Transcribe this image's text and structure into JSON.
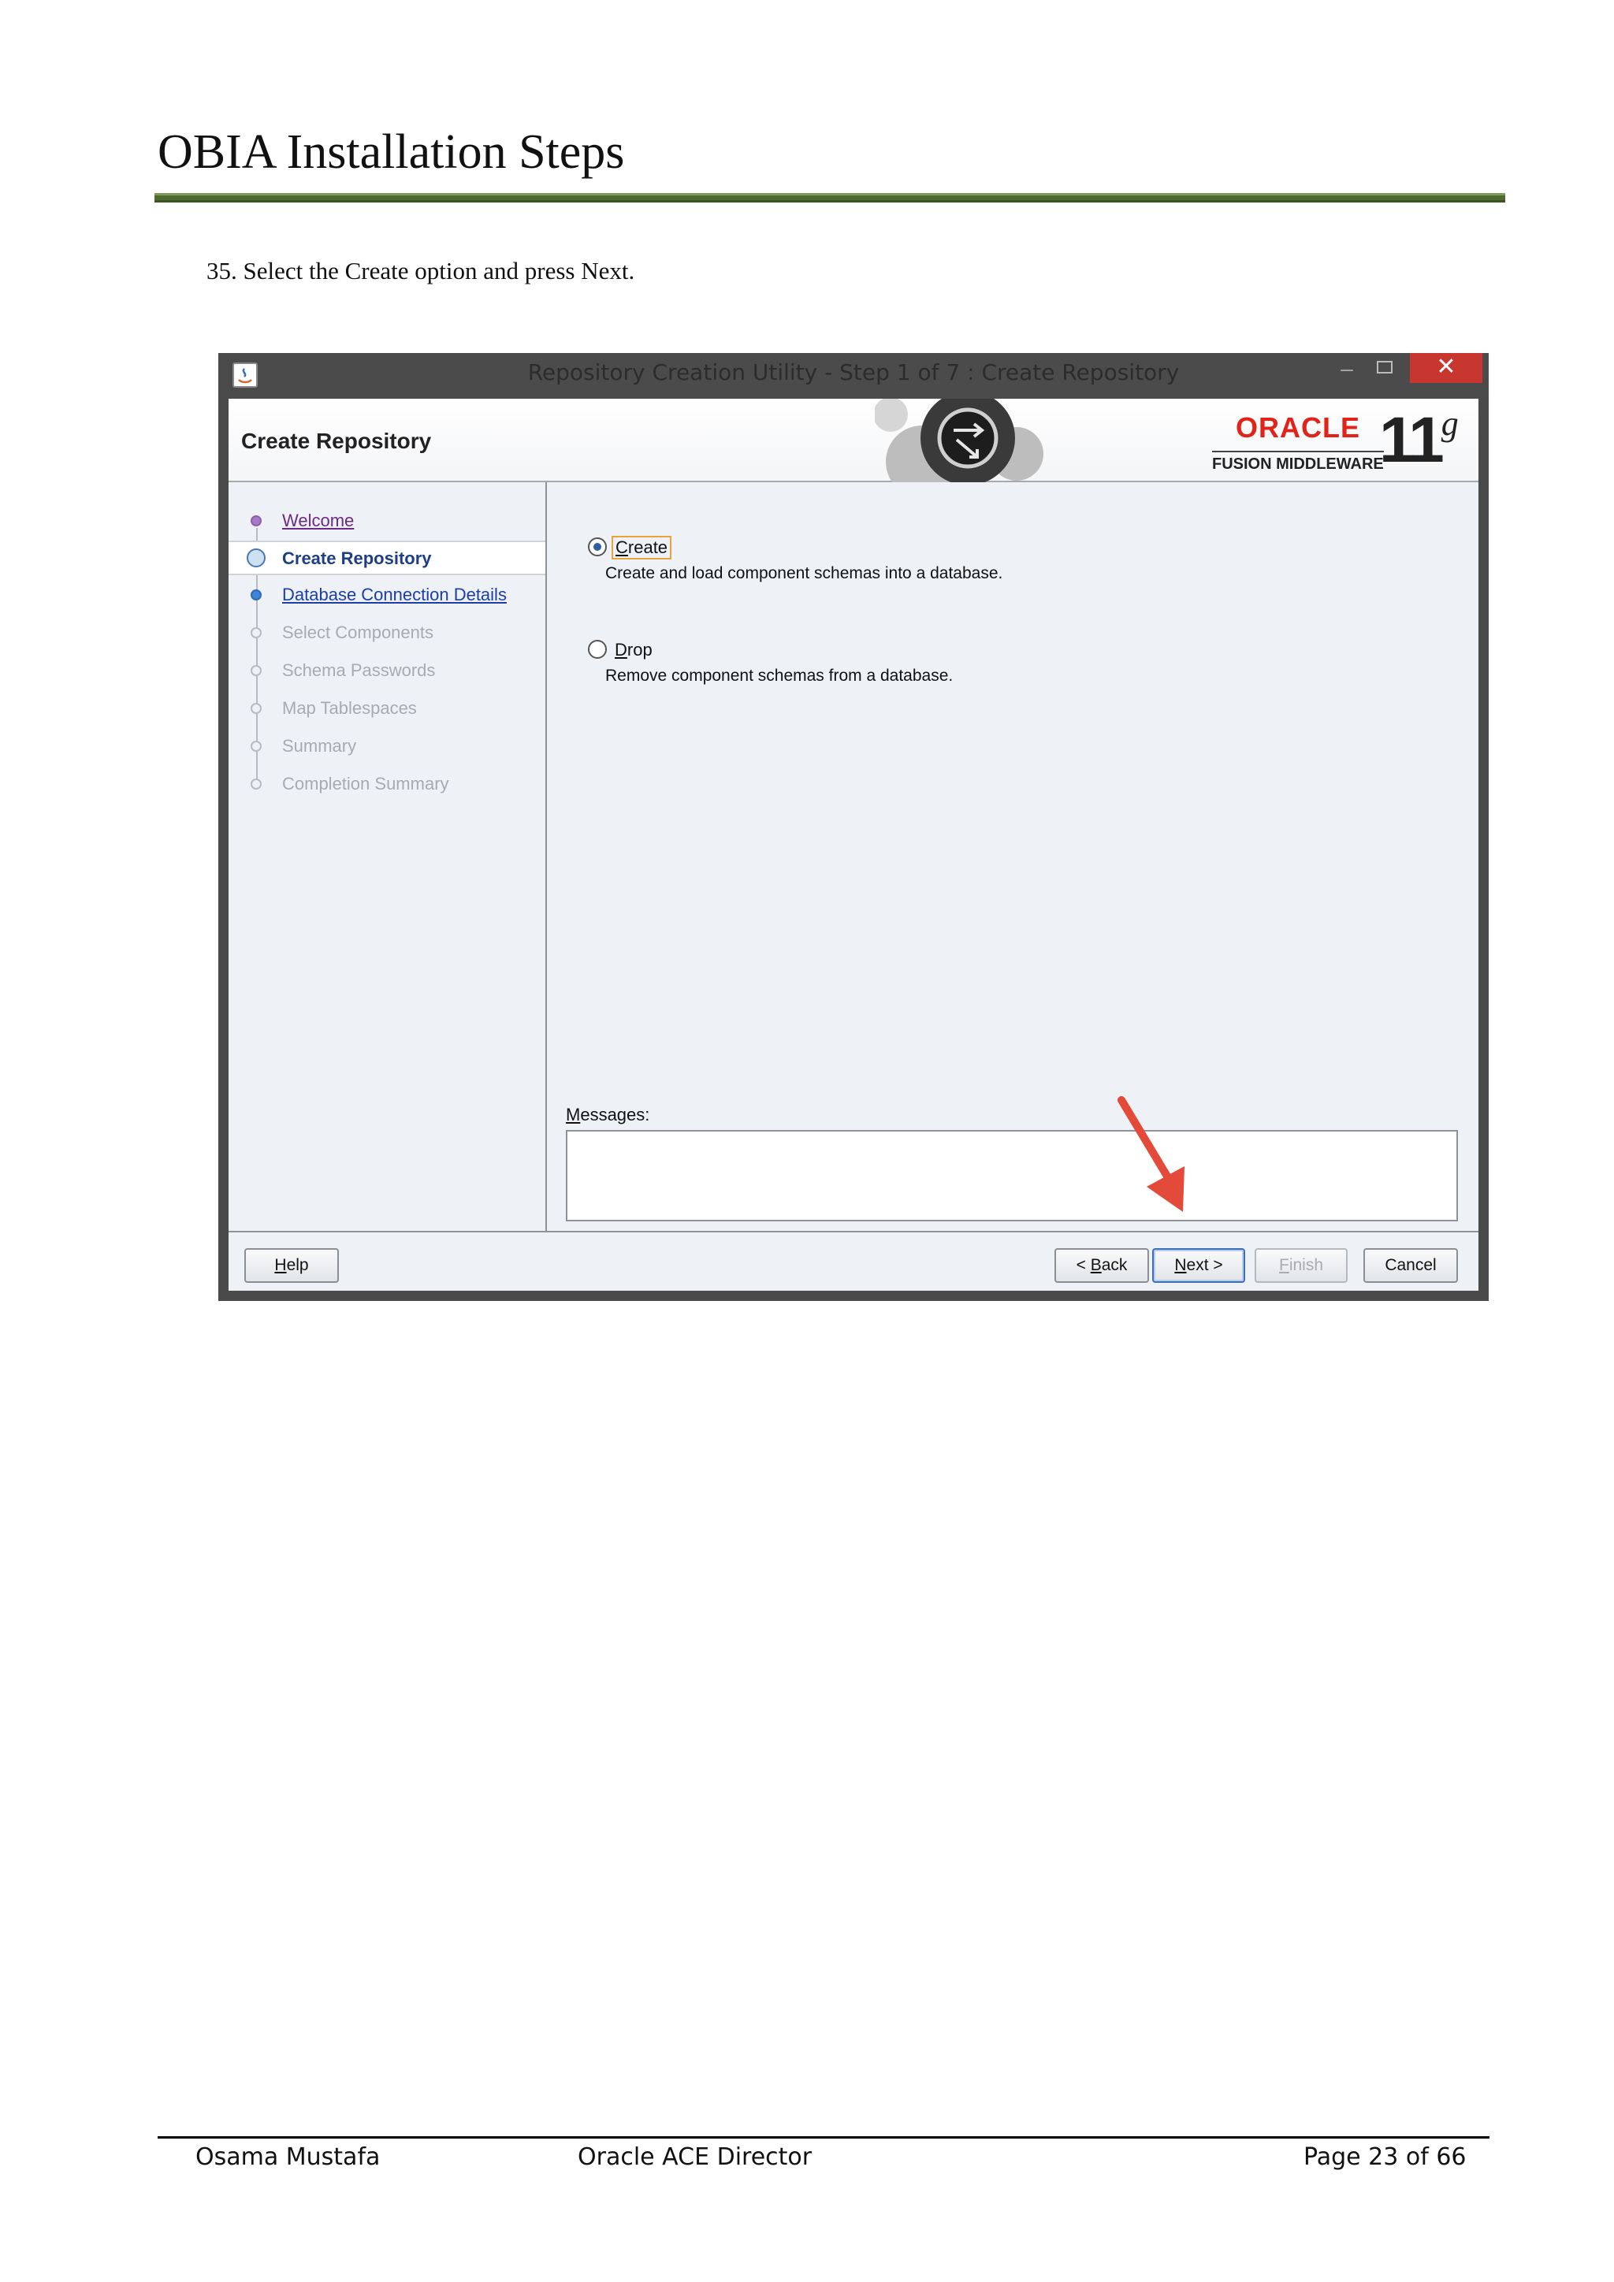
{
  "document": {
    "title": "OBIA Installation Steps",
    "step": "35.  Select the Create option and press Next."
  },
  "window": {
    "title": "Repository Creation Utility - Step 1 of 7 : Create Repository",
    "close_glyph": "✕",
    "minimize_glyph": "–",
    "heading": "Create Repository",
    "brand": {
      "oracle": "ORACLE",
      "fusion": "FUSION MIDDLEWARE",
      "version": "11",
      "version_suffix": "g"
    }
  },
  "nav": {
    "items": [
      {
        "label": "Welcome"
      },
      {
        "label": "Create Repository"
      },
      {
        "label": "Database Connection Details"
      },
      {
        "label": "Select Components"
      },
      {
        "label": "Schema Passwords"
      },
      {
        "label": "Map Tablespaces"
      },
      {
        "label": "Summary"
      },
      {
        "label": "Completion Summary"
      }
    ]
  },
  "options": {
    "create": {
      "mnemonic": "C",
      "rest": "reate",
      "desc": "Create and load component schemas into a database.",
      "selected": true
    },
    "drop": {
      "mnemonic": "D",
      "rest": "rop",
      "desc": "Remove component schemas from a database.",
      "selected": false
    }
  },
  "messages": {
    "mnemonic": "M",
    "rest": "essages:"
  },
  "buttons": {
    "help": {
      "mnemonic": "H",
      "rest": "elp"
    },
    "back": {
      "pre": "< ",
      "mnemonic": "B",
      "rest": "ack"
    },
    "next": {
      "mnemonic": "N",
      "rest": "ext >"
    },
    "finish": {
      "mnemonic": "F",
      "rest": "inish"
    },
    "cancel": {
      "label": "Cancel"
    }
  },
  "footer": {
    "author": "Osama Mustafa",
    "role": "Oracle ACE Director",
    "page": "Page 23 of 66"
  },
  "colors": {
    "accent_red": "#e2231a",
    "rule_green": "#4f6a2f",
    "close_red": "#c7372f"
  }
}
